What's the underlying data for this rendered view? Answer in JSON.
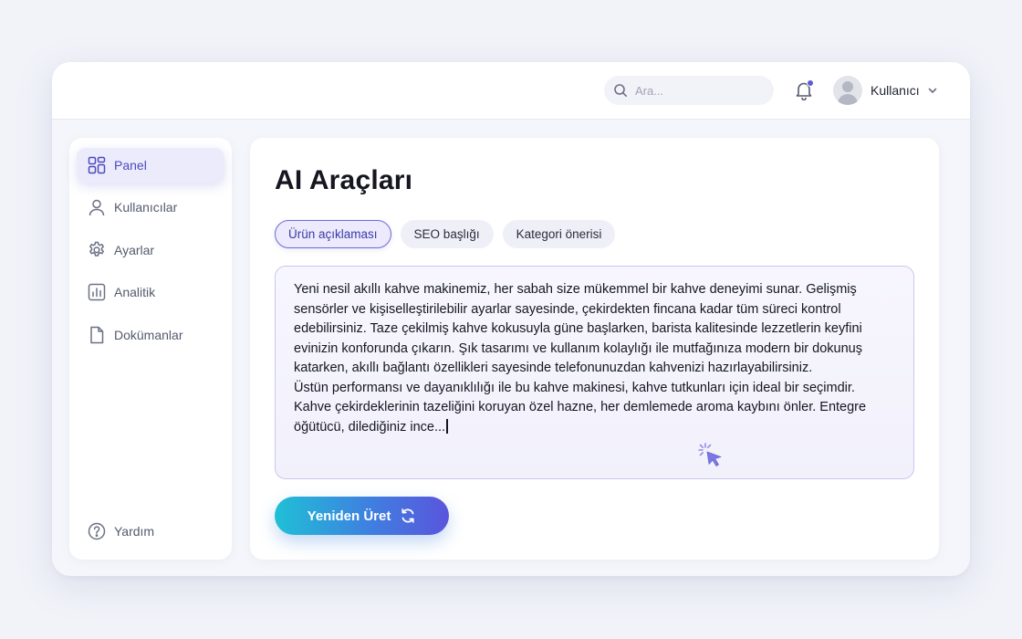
{
  "header": {
    "search": {
      "placeholder": "Ara..."
    },
    "notification": {
      "has_unread": true,
      "dot_color": "#5b5bd6"
    },
    "user": {
      "name": "Kullanıcı"
    }
  },
  "sidebar": {
    "items": [
      {
        "label": "Panel",
        "icon": "dashboard-icon",
        "active": true
      },
      {
        "label": "Kullanıcılar",
        "icon": "user-icon",
        "active": false
      },
      {
        "label": "Ayarlar",
        "icon": "gear-icon",
        "active": false
      },
      {
        "label": "Analitik",
        "icon": "chart-icon",
        "active": false
      },
      {
        "label": "Dokümanlar",
        "icon": "document-icon",
        "active": false
      }
    ],
    "help": {
      "label": "Yardım",
      "icon": "help-icon"
    }
  },
  "main": {
    "title": "AI Araçları",
    "tabs": [
      {
        "label": "Ürün açıklaması",
        "active": true
      },
      {
        "label": "SEO başlığı",
        "active": false
      },
      {
        "label": "Kategori önerisi",
        "active": false
      }
    ],
    "editor": {
      "paragraph1": "Yeni nesil akıllı kahve makinemiz, her sabah size mükemmel bir kahve deneyimi sunar. Gelişmiş sensörler ve kişiselleştirilebilir ayarlar sayesinde, çekirdekten fincana kadar tüm süreci kontrol edebilirsiniz. Taze çekilmiş kahve kokusuyla güne başlarken, barista kalitesinde lezzetlerin keyfini evinizin konforunda çıkarın. Şık tasarımı ve kullanım kolaylığı ile mutfağınıza modern bir dokunuş katarken, akıllı bağlantı özellikleri sayesinde telefonunuzdan kahvenizi hazırlayabilirsiniz.",
      "paragraph2": "Üstün performansı ve dayanıklılığı ile bu kahve makinesi, kahve tutkunları için ideal bir seçimdir. Kahve çekirdeklerinin tazeliğini koruyan özel hazne, her demlemede aroma kaybını önler. Entegre öğütücü, dilediğiniz ince..."
    },
    "regenerate_button": {
      "label": "Yeniden Üret",
      "icon": "refresh-icon"
    }
  },
  "colors": {
    "accent": "#5b5bd6",
    "button_gradient_start": "#1fc0d6",
    "button_gradient_end": "#5a55dc"
  }
}
